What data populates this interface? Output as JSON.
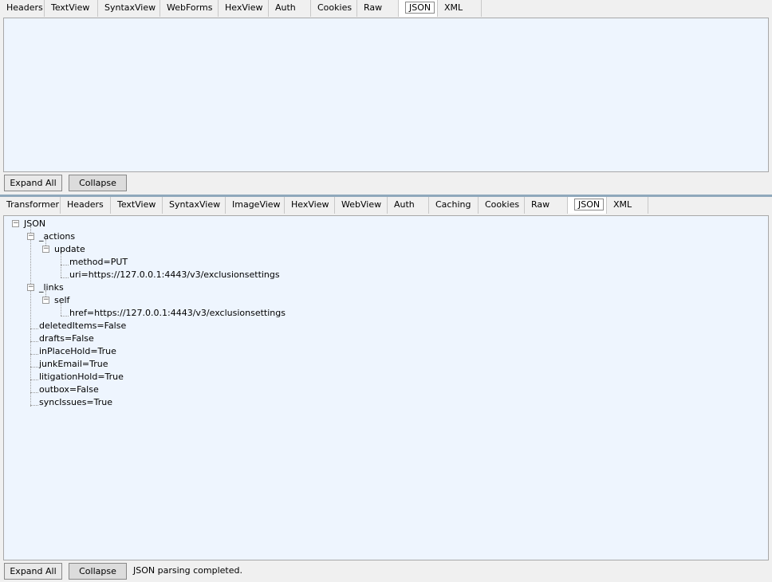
{
  "request": {
    "tabs": [
      "Headers",
      "TextView",
      "SyntaxView",
      "WebForms",
      "HexView",
      "Auth",
      "Cookies",
      "Raw",
      "JSON",
      "XML"
    ],
    "active_tab": "JSON",
    "buttons": {
      "expand_all": "Expand All",
      "collapse": "Collapse"
    }
  },
  "response": {
    "tabs": [
      "Transformer",
      "Headers",
      "TextView",
      "SyntaxView",
      "ImageView",
      "HexView",
      "WebView",
      "Auth",
      "Caching",
      "Cookies",
      "Raw",
      "JSON",
      "XML"
    ],
    "active_tab": "JSON",
    "buttons": {
      "expand_all": "Expand All",
      "collapse": "Collapse"
    },
    "status": "JSON parsing completed.",
    "tree": {
      "root": "JSON",
      "actions": "_actions",
      "update": "update",
      "method": "method=PUT",
      "uri": "uri=https://127.0.0.1:4443/v3/exclusionsettings",
      "links": "_links",
      "self": "self",
      "href": "href=https://127.0.0.1:4443/v3/exclusionsettings",
      "deletedItems": "deletedItems=False",
      "drafts": "drafts=False",
      "inPlaceHold": "inPlaceHold=True",
      "junkEmail": "junkEmail=True",
      "litigationHold": "litigationHold=True",
      "outbox": "outbox=False",
      "syncIssues": "syncIssues=True"
    }
  },
  "icons": {
    "expander": "minus-box-icon"
  }
}
